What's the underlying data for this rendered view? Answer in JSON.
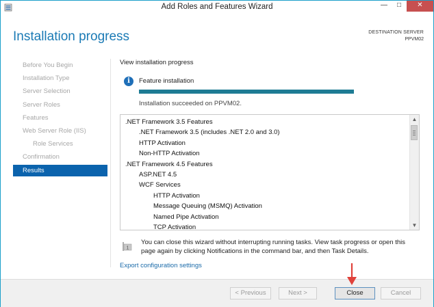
{
  "window": {
    "title": "Add Roles and Features Wizard",
    "minimize_glyph": "—",
    "maximize_glyph": "□",
    "close_glyph": "✕"
  },
  "header": {
    "page_title": "Installation progress",
    "destination_label": "DESTINATION SERVER",
    "destination_server": "PPVM02"
  },
  "sidebar": {
    "items": [
      {
        "label": "Before You Begin",
        "state": "disabled"
      },
      {
        "label": "Installation Type",
        "state": "disabled"
      },
      {
        "label": "Server Selection",
        "state": "disabled"
      },
      {
        "label": "Server Roles",
        "state": "disabled"
      },
      {
        "label": "Features",
        "state": "disabled"
      },
      {
        "label": "Web Server Role (IIS)",
        "state": "disabled"
      },
      {
        "label": "Role Services",
        "state": "disabled",
        "sub": true
      },
      {
        "label": "Confirmation",
        "state": "disabled"
      },
      {
        "label": "Results",
        "state": "active"
      }
    ]
  },
  "main": {
    "heading": "View installation progress",
    "info_icon": "info-icon",
    "feature_title": "Feature installation",
    "progress_fraction": 1.0,
    "status_text": "Installation succeeded on PPVM02.",
    "results": [
      {
        "text": ".NET Framework 3.5 Features",
        "level": 0
      },
      {
        "text": ".NET Framework 3.5 (includes .NET 2.0 and 3.0)",
        "level": 1
      },
      {
        "text": "HTTP Activation",
        "level": 1
      },
      {
        "text": "Non-HTTP Activation",
        "level": 1
      },
      {
        "text": ".NET Framework 4.5 Features",
        "level": 0
      },
      {
        "text": "ASP.NET 4.5",
        "level": 1
      },
      {
        "text": "WCF Services",
        "level": 1
      },
      {
        "text": "HTTP Activation",
        "level": 2
      },
      {
        "text": "Message Queuing (MSMQ) Activation",
        "level": 2
      },
      {
        "text": "Named Pipe Activation",
        "level": 2
      },
      {
        "text": "TCP Activation",
        "level": 2
      }
    ],
    "note_icon": "flag-note-icon",
    "note_icon_badge": "1",
    "note_text": "You can close this wizard without interrupting running tasks. View task progress or open this page again by clicking Notifications in the command bar, and then Task Details.",
    "export_link": "Export configuration settings"
  },
  "footer": {
    "previous_label": "< Previous",
    "next_label": "Next >",
    "close_label": "Close",
    "cancel_label": "Cancel"
  },
  "colors": {
    "accent": "#1a7ab5",
    "nav_active": "#0b63ad",
    "progress": "#1e7c94",
    "annotation_arrow": "#e0413a"
  }
}
